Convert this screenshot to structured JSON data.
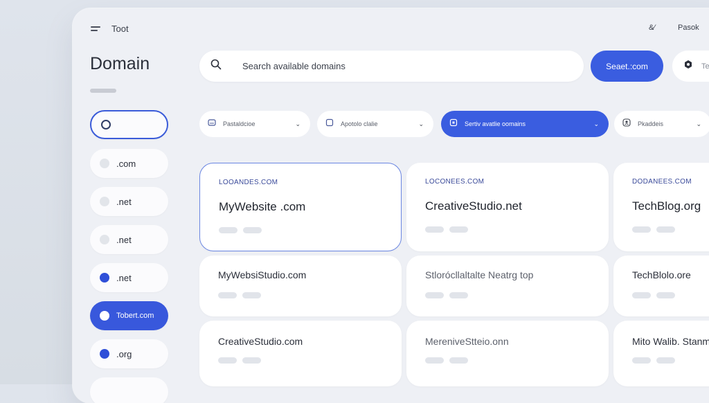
{
  "app": {
    "title": "Toot",
    "top_right_1": "&⁄",
    "top_right_2": "Pasok"
  },
  "page_title": "Domain",
  "sidebar": {
    "items": [
      {
        "label": "",
        "style": "outlined"
      },
      {
        "label": ".com",
        "style": "plain"
      },
      {
        "label": ".net",
        "style": "plain"
      },
      {
        "label": ".net",
        "style": "plain"
      },
      {
        "label": ".net",
        "style": "blue-dot"
      },
      {
        "label": "Tobert.com",
        "style": "active"
      },
      {
        "label": ".org",
        "style": "blue-dot"
      }
    ]
  },
  "search": {
    "placeholder": "Search available domains",
    "button_label": "Seaet.:com",
    "extra_label": "Te"
  },
  "filters": [
    {
      "label": "Pastaldcioe"
    },
    {
      "label": "Apotolo clalie"
    },
    {
      "label": "Sertiv avatlie oomains"
    },
    {
      "label": "Pkaddeis"
    }
  ],
  "cards": [
    {
      "category": "LOOANDES.COM",
      "name": "MyWebsite .com"
    },
    {
      "category": "LOCONEES.COM",
      "name": "CreativeStudio.net"
    },
    {
      "category": "DODANEES.COM",
      "name": "TechBlog.org"
    },
    {
      "category": "",
      "name": "MyWebsiStudio.com"
    },
    {
      "category": "",
      "name": "Stlorócllaltalte Neatrg top"
    },
    {
      "category": "",
      "name": "TechBlolo.ore"
    },
    {
      "category": "",
      "name": "CreativeStudio.com"
    },
    {
      "category": "",
      "name": "MerenivеStteio.onn"
    },
    {
      "category": "",
      "name": "Mito Walib. Stanm"
    }
  ],
  "colors": {
    "accent": "#3a5de0",
    "background": "#eef0f5",
    "card": "#ffffff"
  }
}
